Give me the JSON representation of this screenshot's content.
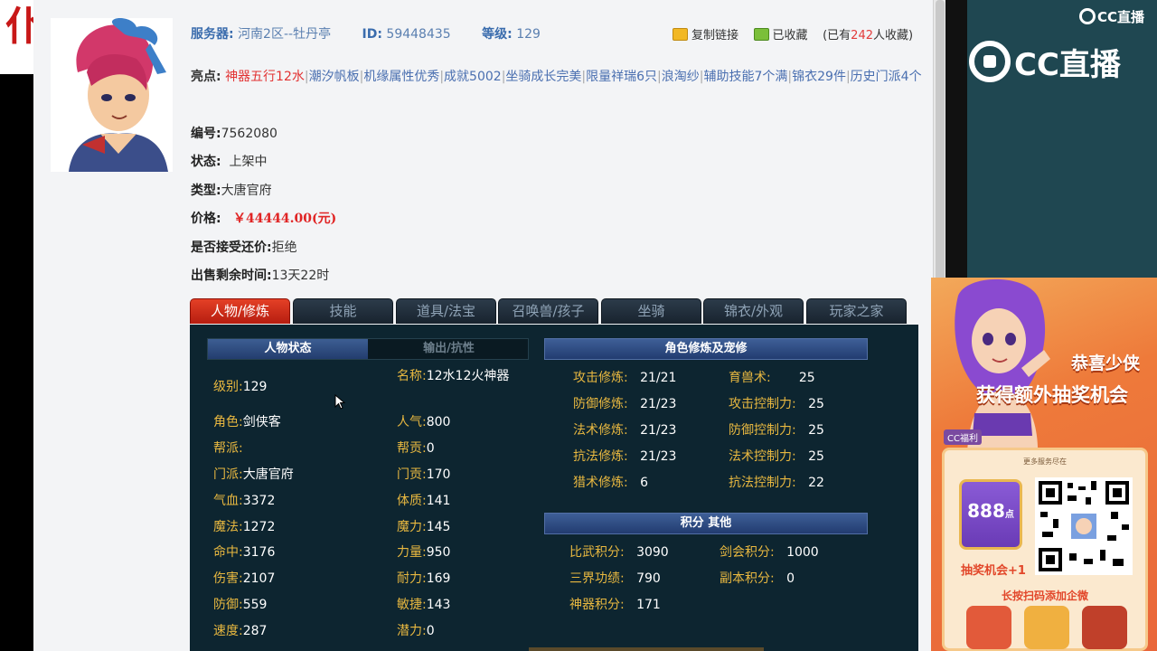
{
  "left_logo": {
    "char": "仆"
  },
  "header": {
    "server_label": "服务器:",
    "server_value": "河南2区--牡丹亭",
    "id_label": "ID:",
    "id_value": "59448435",
    "level_label": "等级:",
    "level_value": "129",
    "copy_link": "复制链接",
    "favorited": "已收藏",
    "fav_count_prefix": "(已有",
    "fav_count": "242",
    "fav_count_suffix": "人收藏)"
  },
  "highlights": {
    "label": "亮点:",
    "items": [
      "神器五行12水",
      "潮汐帆板",
      "机缘属性优秀",
      "成就5002",
      "坐骑成长完美",
      "限量祥瑞6只",
      "浪淘纱",
      "辅助技能7个满",
      "锦衣29件",
      "历史门派4个"
    ]
  },
  "info": {
    "serial_label": "编号:",
    "serial_value": "7562080",
    "status_label": "状态:",
    "status_value": "上架中",
    "type_label": "类型:",
    "type_value": "大唐官府",
    "price_label": "价格:",
    "price_value": "￥44444.00(元)",
    "bargain_label": "是否接受还价:",
    "bargain_value": "拒绝",
    "remaining_label": "出售剩余时间:",
    "remaining_value": "13天22时"
  },
  "tabs": [
    "人物/修炼",
    "技能",
    "道具/法宝",
    "召唤兽/孩子",
    "坐骑",
    "锦衣/外观",
    "玩家之家"
  ],
  "sub_tabs": {
    "active": "人物状态",
    "inactive": "输出/抗性"
  },
  "character": {
    "left": [
      {
        "k": "级别:",
        "v": "129"
      },
      {
        "k": "角色:",
        "v": "剑侠客"
      },
      {
        "k": "帮派:",
        "v": ""
      },
      {
        "k": "门派:",
        "v": "大唐官府"
      },
      {
        "k": "气血:",
        "v": "3372"
      },
      {
        "k": "魔法:",
        "v": "1272"
      },
      {
        "k": "命中:",
        "v": "3176"
      },
      {
        "k": "伤害:",
        "v": "2107"
      },
      {
        "k": "防御:",
        "v": "559"
      },
      {
        "k": "速度:",
        "v": "287"
      }
    ],
    "right": [
      {
        "k": "名称:",
        "v": "12水12火神器"
      },
      {
        "k": "人气:",
        "v": "800"
      },
      {
        "k": "帮贡:",
        "v": "0"
      },
      {
        "k": "门贡:",
        "v": "170"
      },
      {
        "k": "体质:",
        "v": "141"
      },
      {
        "k": "魔力:",
        "v": "145"
      },
      {
        "k": "力量:",
        "v": "950"
      },
      {
        "k": "耐力:",
        "v": "169"
      },
      {
        "k": "敏捷:",
        "v": "143"
      },
      {
        "k": "潜力:",
        "v": "0"
      }
    ]
  },
  "cultivation": {
    "title": "角色修炼及宠修",
    "left": [
      {
        "k": "攻击修炼:",
        "v": "21/21"
      },
      {
        "k": "防御修炼:",
        "v": "21/23"
      },
      {
        "k": "法术修炼:",
        "v": "21/23"
      },
      {
        "k": "抗法修炼:",
        "v": "21/23"
      },
      {
        "k": "猎术修炼:",
        "v": "6"
      }
    ],
    "right": [
      {
        "k": "育兽术:",
        "v": "25"
      },
      {
        "k": "攻击控制力:",
        "v": "25"
      },
      {
        "k": "防御控制力:",
        "v": "25"
      },
      {
        "k": "法术控制力:",
        "v": "25"
      },
      {
        "k": "抗法控制力:",
        "v": "22"
      }
    ]
  },
  "scores": {
    "title": "积分 其他",
    "left": [
      {
        "k": "比武积分:",
        "v": "3090"
      },
      {
        "k": "三界功绩:",
        "v": "790"
      },
      {
        "k": "神器积分:",
        "v": "171"
      }
    ],
    "right": [
      {
        "k": "剑会积分:",
        "v": "1000"
      },
      {
        "k": "副本积分:",
        "v": "0"
      }
    ]
  },
  "stream": {
    "brand_small": "CC直播",
    "brand_big": "CC直播"
  },
  "promo": {
    "congrats": "恭喜少侠",
    "reward": "获得额外抽奖机会",
    "cc_tag": "CC福利",
    "more": "更多服务尽在",
    "coin_num": "888",
    "coin_unit": "点",
    "lottery": "抽奖机会+1",
    "scan": "长按扫码添加企微"
  }
}
